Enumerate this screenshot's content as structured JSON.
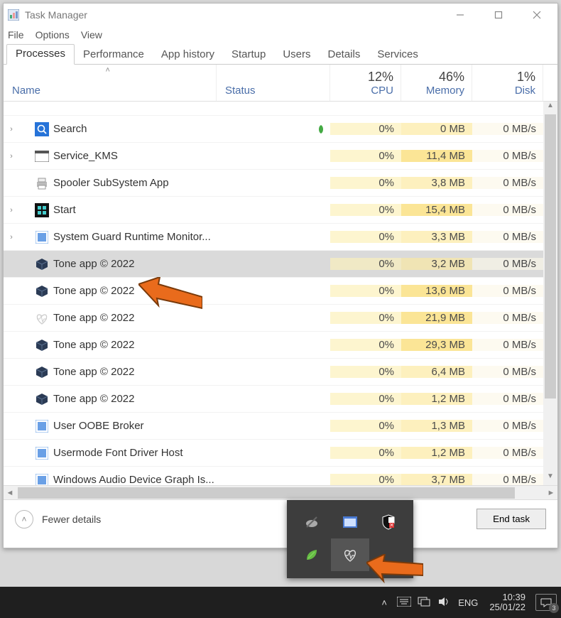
{
  "window": {
    "title": "Task Manager",
    "min": "—",
    "max": "□",
    "close": "✕"
  },
  "menu": {
    "file": "File",
    "options": "Options",
    "view": "View"
  },
  "tabs": {
    "items": [
      {
        "label": "Processes",
        "active": true
      },
      {
        "label": "Performance"
      },
      {
        "label": "App history"
      },
      {
        "label": "Startup"
      },
      {
        "label": "Users"
      },
      {
        "label": "Details"
      },
      {
        "label": "Services"
      }
    ]
  },
  "columns": {
    "name": "Name",
    "status": "Status",
    "cpu": {
      "pct": "12%",
      "label": "CPU"
    },
    "memory": {
      "pct": "46%",
      "label": "Memory"
    },
    "disk": {
      "pct": "1%",
      "label": "Disk"
    }
  },
  "rows": [
    {
      "exp": true,
      "icon": "search",
      "name": "Search",
      "leaf": true,
      "cpu": "0%",
      "mem": "0 MB",
      "disk": "0 MB/s"
    },
    {
      "exp": true,
      "icon": "window",
      "name": "Service_KMS",
      "cpu": "0%",
      "mem": "11,4 MB",
      "disk": "0 MB/s"
    },
    {
      "exp": false,
      "icon": "printer",
      "name": "Spooler SubSystem App",
      "cpu": "0%",
      "mem": "3,8 MB",
      "disk": "0 MB/s"
    },
    {
      "exp": true,
      "icon": "start",
      "name": "Start",
      "cpu": "0%",
      "mem": "15,4 MB",
      "disk": "0 MB/s"
    },
    {
      "exp": true,
      "icon": "app",
      "name": "System Guard Runtime Monitor...",
      "cpu": "0%",
      "mem": "3,3 MB",
      "disk": "0 MB/s"
    },
    {
      "exp": false,
      "icon": "cube",
      "name": "Tone app © 2022",
      "sel": true,
      "cpu": "0%",
      "mem": "3,2 MB",
      "disk": "0 MB/s"
    },
    {
      "exp": false,
      "icon": "cube",
      "name": "Tone app © 2022",
      "cpu": "0%",
      "mem": "13,6 MB",
      "disk": "0 MB/s"
    },
    {
      "exp": false,
      "icon": "heart",
      "name": "Tone app © 2022",
      "cpu": "0%",
      "mem": "21,9 MB",
      "disk": "0 MB/s"
    },
    {
      "exp": false,
      "icon": "cube",
      "name": "Tone app © 2022",
      "cpu": "0%",
      "mem": "29,3 MB",
      "disk": "0 MB/s"
    },
    {
      "exp": false,
      "icon": "cube",
      "name": "Tone app © 2022",
      "cpu": "0%",
      "mem": "6,4 MB",
      "disk": "0 MB/s"
    },
    {
      "exp": false,
      "icon": "cube",
      "name": "Tone app © 2022",
      "cpu": "0%",
      "mem": "1,2 MB",
      "disk": "0 MB/s"
    },
    {
      "exp": false,
      "icon": "app",
      "name": "User OOBE Broker",
      "cpu": "0%",
      "mem": "1,3 MB",
      "disk": "0 MB/s"
    },
    {
      "exp": false,
      "icon": "app",
      "name": "Usermode Font Driver Host",
      "cpu": "0%",
      "mem": "1,2 MB",
      "disk": "0 MB/s"
    },
    {
      "exp": false,
      "icon": "app",
      "name": "Windows Audio Device Graph Is...",
      "cpu": "0%",
      "mem": "3,7 MB",
      "disk": "0 MB/s"
    }
  ],
  "footer": {
    "fewer": "Fewer details",
    "endtask": "End task"
  },
  "tray_icons": [
    "cloud-off",
    "window",
    "shield-x",
    "leaf",
    "heart"
  ],
  "taskbar": {
    "lang": "ENG",
    "time": "10:39",
    "date": "25/01/22",
    "notif_count": "3"
  },
  "colors": {
    "accent": "#e96b1c"
  }
}
